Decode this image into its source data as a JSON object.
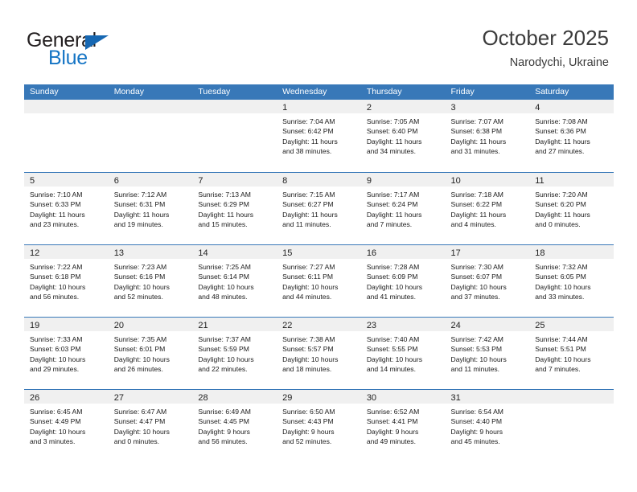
{
  "brand": {
    "name_top": "General",
    "name_bottom": "Blue",
    "accent_color": "#1474c4",
    "triangle_color": "#1667b2",
    "triangle_icon": "triangle-icon"
  },
  "header": {
    "title": "October 2025",
    "subtitle": "Narodychi, Ukraine"
  },
  "colors": {
    "header_row_bg": "#3878b8",
    "header_row_text": "#ffffff",
    "daynum_band_bg": "#f0f0f0",
    "row_divider": "#3878b8",
    "body_text": "#1a1a1a"
  },
  "weekdays": [
    "Sunday",
    "Monday",
    "Tuesday",
    "Wednesday",
    "Thursday",
    "Friday",
    "Saturday"
  ],
  "labels": {
    "sunrise_prefix": "Sunrise:",
    "sunset_prefix": "Sunset:",
    "daylight_prefix": "Daylight:"
  },
  "weeks": [
    {
      "days": [
        {
          "empty": true,
          "date": "",
          "line1": "",
          "line2": "",
          "line3": "",
          "line4": ""
        },
        {
          "empty": true,
          "date": "",
          "line1": "",
          "line2": "",
          "line3": "",
          "line4": ""
        },
        {
          "empty": true,
          "date": "",
          "line1": "",
          "line2": "",
          "line3": "",
          "line4": ""
        },
        {
          "empty": false,
          "date": "1",
          "line1": "Sunrise: 7:04 AM",
          "line2": "Sunset: 6:42 PM",
          "line3": "Daylight: 11 hours",
          "line4": "and 38 minutes."
        },
        {
          "empty": false,
          "date": "2",
          "line1": "Sunrise: 7:05 AM",
          "line2": "Sunset: 6:40 PM",
          "line3": "Daylight: 11 hours",
          "line4": "and 34 minutes."
        },
        {
          "empty": false,
          "date": "3",
          "line1": "Sunrise: 7:07 AM",
          "line2": "Sunset: 6:38 PM",
          "line3": "Daylight: 11 hours",
          "line4": "and 31 minutes."
        },
        {
          "empty": false,
          "date": "4",
          "line1": "Sunrise: 7:08 AM",
          "line2": "Sunset: 6:36 PM",
          "line3": "Daylight: 11 hours",
          "line4": "and 27 minutes."
        }
      ]
    },
    {
      "days": [
        {
          "empty": false,
          "date": "5",
          "line1": "Sunrise: 7:10 AM",
          "line2": "Sunset: 6:33 PM",
          "line3": "Daylight: 11 hours",
          "line4": "and 23 minutes."
        },
        {
          "empty": false,
          "date": "6",
          "line1": "Sunrise: 7:12 AM",
          "line2": "Sunset: 6:31 PM",
          "line3": "Daylight: 11 hours",
          "line4": "and 19 minutes."
        },
        {
          "empty": false,
          "date": "7",
          "line1": "Sunrise: 7:13 AM",
          "line2": "Sunset: 6:29 PM",
          "line3": "Daylight: 11 hours",
          "line4": "and 15 minutes."
        },
        {
          "empty": false,
          "date": "8",
          "line1": "Sunrise: 7:15 AM",
          "line2": "Sunset: 6:27 PM",
          "line3": "Daylight: 11 hours",
          "line4": "and 11 minutes."
        },
        {
          "empty": false,
          "date": "9",
          "line1": "Sunrise: 7:17 AM",
          "line2": "Sunset: 6:24 PM",
          "line3": "Daylight: 11 hours",
          "line4": "and 7 minutes."
        },
        {
          "empty": false,
          "date": "10",
          "line1": "Sunrise: 7:18 AM",
          "line2": "Sunset: 6:22 PM",
          "line3": "Daylight: 11 hours",
          "line4": "and 4 minutes."
        },
        {
          "empty": false,
          "date": "11",
          "line1": "Sunrise: 7:20 AM",
          "line2": "Sunset: 6:20 PM",
          "line3": "Daylight: 11 hours",
          "line4": "and 0 minutes."
        }
      ]
    },
    {
      "days": [
        {
          "empty": false,
          "date": "12",
          "line1": "Sunrise: 7:22 AM",
          "line2": "Sunset: 6:18 PM",
          "line3": "Daylight: 10 hours",
          "line4": "and 56 minutes."
        },
        {
          "empty": false,
          "date": "13",
          "line1": "Sunrise: 7:23 AM",
          "line2": "Sunset: 6:16 PM",
          "line3": "Daylight: 10 hours",
          "line4": "and 52 minutes."
        },
        {
          "empty": false,
          "date": "14",
          "line1": "Sunrise: 7:25 AM",
          "line2": "Sunset: 6:14 PM",
          "line3": "Daylight: 10 hours",
          "line4": "and 48 minutes."
        },
        {
          "empty": false,
          "date": "15",
          "line1": "Sunrise: 7:27 AM",
          "line2": "Sunset: 6:11 PM",
          "line3": "Daylight: 10 hours",
          "line4": "and 44 minutes."
        },
        {
          "empty": false,
          "date": "16",
          "line1": "Sunrise: 7:28 AM",
          "line2": "Sunset: 6:09 PM",
          "line3": "Daylight: 10 hours",
          "line4": "and 41 minutes."
        },
        {
          "empty": false,
          "date": "17",
          "line1": "Sunrise: 7:30 AM",
          "line2": "Sunset: 6:07 PM",
          "line3": "Daylight: 10 hours",
          "line4": "and 37 minutes."
        },
        {
          "empty": false,
          "date": "18",
          "line1": "Sunrise: 7:32 AM",
          "line2": "Sunset: 6:05 PM",
          "line3": "Daylight: 10 hours",
          "line4": "and 33 minutes."
        }
      ]
    },
    {
      "days": [
        {
          "empty": false,
          "date": "19",
          "line1": "Sunrise: 7:33 AM",
          "line2": "Sunset: 6:03 PM",
          "line3": "Daylight: 10 hours",
          "line4": "and 29 minutes."
        },
        {
          "empty": false,
          "date": "20",
          "line1": "Sunrise: 7:35 AM",
          "line2": "Sunset: 6:01 PM",
          "line3": "Daylight: 10 hours",
          "line4": "and 26 minutes."
        },
        {
          "empty": false,
          "date": "21",
          "line1": "Sunrise: 7:37 AM",
          "line2": "Sunset: 5:59 PM",
          "line3": "Daylight: 10 hours",
          "line4": "and 22 minutes."
        },
        {
          "empty": false,
          "date": "22",
          "line1": "Sunrise: 7:38 AM",
          "line2": "Sunset: 5:57 PM",
          "line3": "Daylight: 10 hours",
          "line4": "and 18 minutes."
        },
        {
          "empty": false,
          "date": "23",
          "line1": "Sunrise: 7:40 AM",
          "line2": "Sunset: 5:55 PM",
          "line3": "Daylight: 10 hours",
          "line4": "and 14 minutes."
        },
        {
          "empty": false,
          "date": "24",
          "line1": "Sunrise: 7:42 AM",
          "line2": "Sunset: 5:53 PM",
          "line3": "Daylight: 10 hours",
          "line4": "and 11 minutes."
        },
        {
          "empty": false,
          "date": "25",
          "line1": "Sunrise: 7:44 AM",
          "line2": "Sunset: 5:51 PM",
          "line3": "Daylight: 10 hours",
          "line4": "and 7 minutes."
        }
      ]
    },
    {
      "days": [
        {
          "empty": false,
          "date": "26",
          "line1": "Sunrise: 6:45 AM",
          "line2": "Sunset: 4:49 PM",
          "line3": "Daylight: 10 hours",
          "line4": "and 3 minutes."
        },
        {
          "empty": false,
          "date": "27",
          "line1": "Sunrise: 6:47 AM",
          "line2": "Sunset: 4:47 PM",
          "line3": "Daylight: 10 hours",
          "line4": "and 0 minutes."
        },
        {
          "empty": false,
          "date": "28",
          "line1": "Sunrise: 6:49 AM",
          "line2": "Sunset: 4:45 PM",
          "line3": "Daylight: 9 hours",
          "line4": "and 56 minutes."
        },
        {
          "empty": false,
          "date": "29",
          "line1": "Sunrise: 6:50 AM",
          "line2": "Sunset: 4:43 PM",
          "line3": "Daylight: 9 hours",
          "line4": "and 52 minutes."
        },
        {
          "empty": false,
          "date": "30",
          "line1": "Sunrise: 6:52 AM",
          "line2": "Sunset: 4:41 PM",
          "line3": "Daylight: 9 hours",
          "line4": "and 49 minutes."
        },
        {
          "empty": false,
          "date": "31",
          "line1": "Sunrise: 6:54 AM",
          "line2": "Sunset: 4:40 PM",
          "line3": "Daylight: 9 hours",
          "line4": "and 45 minutes."
        },
        {
          "empty": true,
          "date": "",
          "line1": "",
          "line2": "",
          "line3": "",
          "line4": ""
        }
      ]
    }
  ]
}
